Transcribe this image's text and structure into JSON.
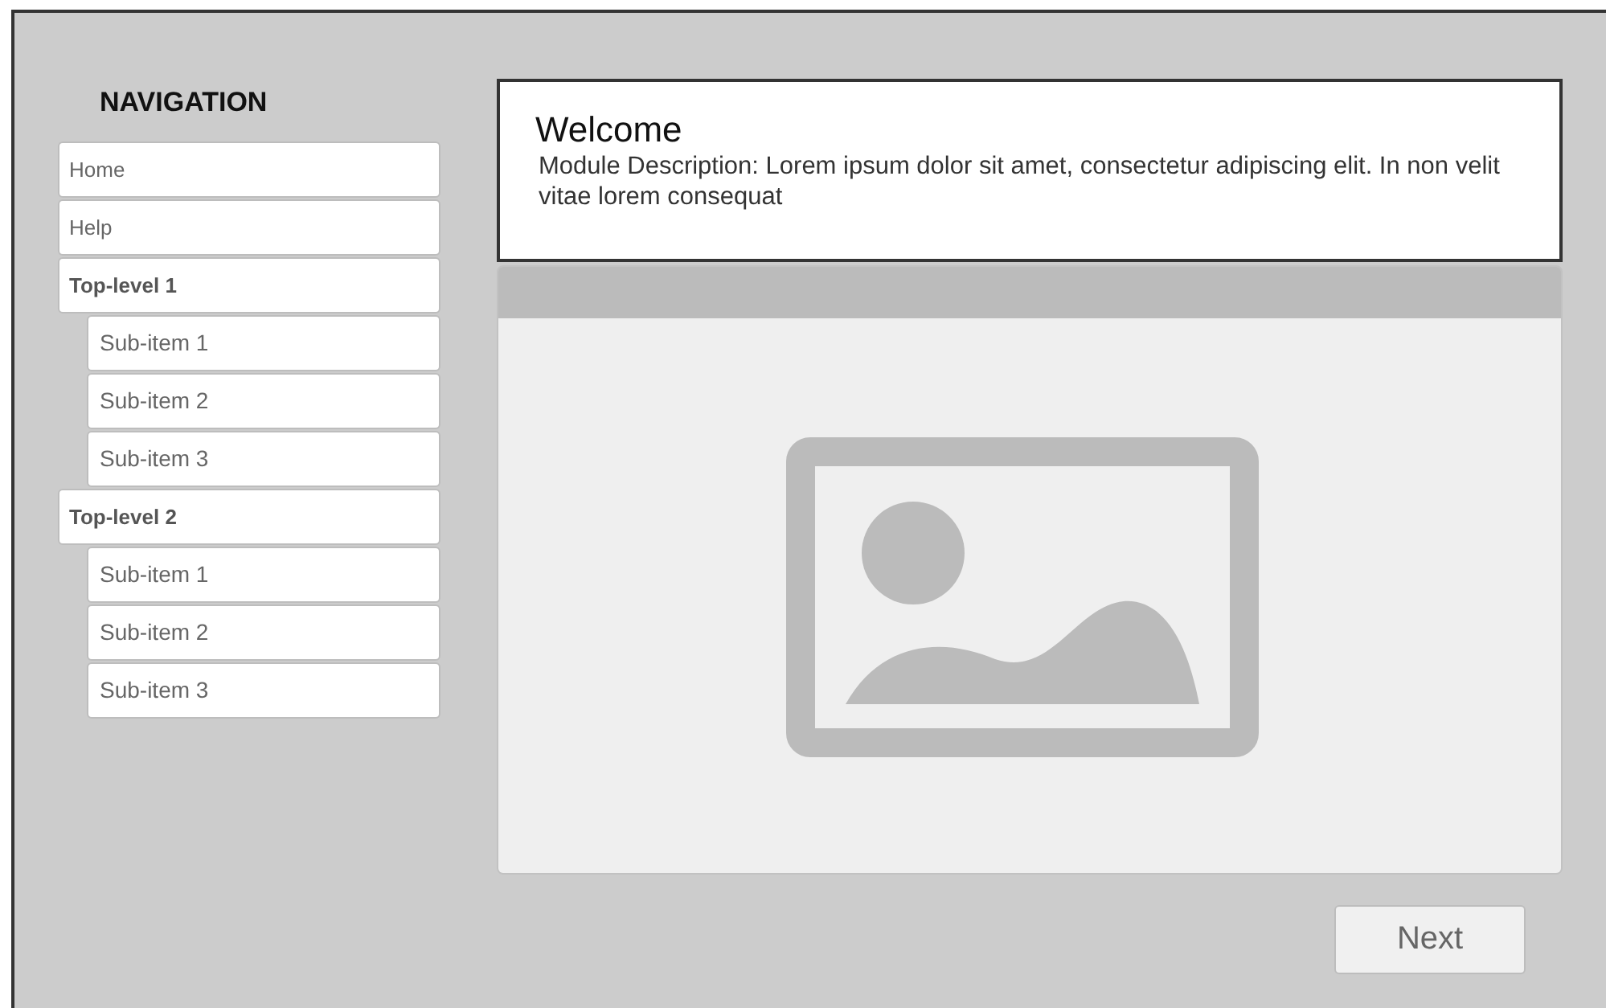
{
  "navigation": {
    "title": "NAVIGATION",
    "items": [
      {
        "label": "Home"
      },
      {
        "label": "Help"
      },
      {
        "label": "Top-level 1",
        "children": [
          {
            "label": "Sub-item 1"
          },
          {
            "label": "Sub-item 2"
          },
          {
            "label": "Sub-item 3"
          }
        ]
      },
      {
        "label": "Top-level 2",
        "children": [
          {
            "label": "Sub-item 1"
          },
          {
            "label": "Sub-item 2"
          },
          {
            "label": "Sub-item 3"
          }
        ]
      }
    ]
  },
  "module": {
    "title": "Welcome",
    "description": "Module Description: Lorem ipsum dolor sit amet, consectetur adipiscing elit. In non velit vitae lorem consequat"
  },
  "buttons": [
    {
      "label": "Next"
    }
  ]
}
